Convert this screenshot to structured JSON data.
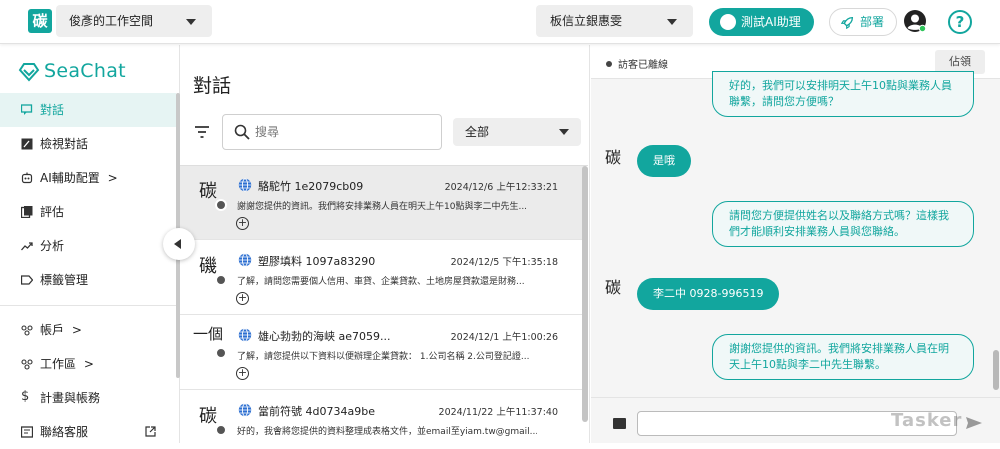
{
  "topbar": {
    "logo_char": "碳",
    "workspace": "俊彥的工作空間",
    "store": "板信立銀惠雯",
    "test_ai_label": "測試AI助理",
    "deploy_label": "部署",
    "help_symbol": "?"
  },
  "sidebar": {
    "brand": "SeaChat",
    "items": [
      {
        "label": "對話",
        "icon": "chat-icon"
      },
      {
        "label": "檢視對話",
        "icon": "review-icon"
      },
      {
        "label": "AI輔助配置",
        "icon": "ai-config-icon",
        "chevron": ">"
      },
      {
        "label": "評估",
        "icon": "evaluate-icon"
      },
      {
        "label": "分析",
        "icon": "analytics-icon"
      },
      {
        "label": "標籤管理",
        "icon": "tag-icon"
      },
      {
        "label": "帳戶",
        "icon": "account-icon",
        "chevron": ">"
      },
      {
        "label": "工作區",
        "icon": "workspace-icon",
        "chevron": ">"
      },
      {
        "label": "計畫與帳務",
        "icon": "billing-icon"
      },
      {
        "label": "聯絡客服",
        "icon": "support-icon"
      }
    ]
  },
  "conversations": {
    "title": "對話",
    "search_placeholder": "搜尋",
    "filter_value": "全部",
    "rows": [
      {
        "avatar": "碳",
        "name": "駱駝竹 1e2079cb09",
        "time": "2024/12/6 上午12:33:21",
        "snippet": "謝謝您提供的資訊。我們將安排業務人員在明天上午10點與李二中先生..."
      },
      {
        "avatar": "磯",
        "name": "塑膠填料 1097a83290",
        "time": "2024/12/5 下午1:35:18",
        "snippet": "了解，請問您需要個人信用、車貸、企業貸款、土地房屋貸款還是財務..."
      },
      {
        "avatar": "一個",
        "name": "雄心勃勃的海峡 ae7059...",
        "time": "2024/12/1 上午1:00:26",
        "snippet": "了解，請您提供以下資料以便辦理企業貸款： 1.公司名稱 2.公司登記證..."
      },
      {
        "avatar": "碳",
        "name": "當前符號 4d0734a9be",
        "time": "2024/11/22 上午11:37:40",
        "snippet": "好的，我會將您提供的資料整理成表格文件，並email至yiam.tw@gmail...."
      }
    ]
  },
  "chat": {
    "status": "訪客已離線",
    "claim_label": "佔領",
    "messages": [
      {
        "from": "bot",
        "text": "好的，我們可以安排明天上午10點與業務人員聯繫，請問您方便嗎？"
      },
      {
        "from": "user",
        "avatar": "碳",
        "text": "是哦"
      },
      {
        "from": "bot",
        "text": "請問您方便提供姓名以及聯絡方式嗎？這樣我們才能順利安排業務人員與您聯絡。"
      },
      {
        "from": "user",
        "avatar": "碳",
        "text": "李二中 0928-996519"
      },
      {
        "from": "bot",
        "text": "謝謝您提供的資訊。我們將安排業務人員在明天上午10點與李二中先生聯繫。"
      }
    ],
    "watermark": "Tasker"
  },
  "colors": {
    "accent": "#12a69e"
  }
}
